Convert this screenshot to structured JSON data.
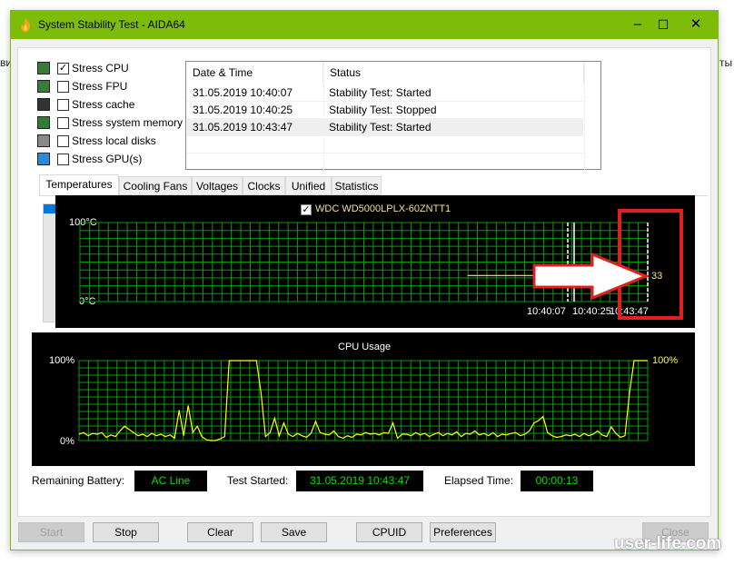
{
  "background_fragments": {
    "left": "ви",
    "right": "ты"
  },
  "window": {
    "title": "System Stability Test - AIDA64",
    "accent": "#7dbd0a",
    "controls": [
      "minimize",
      "maximize",
      "close"
    ]
  },
  "stress_options": [
    {
      "label": "Stress CPU",
      "checked": true,
      "icon": "cpu-icon"
    },
    {
      "label": "Stress FPU",
      "checked": false,
      "icon": "fpu-icon"
    },
    {
      "label": "Stress cache",
      "checked": false,
      "icon": "cache-chip-icon"
    },
    {
      "label": "Stress system memory",
      "checked": false,
      "icon": "memory-module-icon"
    },
    {
      "label": "Stress local disks",
      "checked": false,
      "icon": "disk-drive-icon"
    },
    {
      "label": "Stress GPU(s)",
      "checked": false,
      "icon": "gpu-monitor-icon"
    }
  ],
  "log": {
    "columns": [
      "Date & Time",
      "Status"
    ],
    "rows": [
      {
        "datetime": "31.05.2019 10:40:07",
        "status": "Stability Test: Started"
      },
      {
        "datetime": "31.05.2019 10:40:25",
        "status": "Stability Test: Stopped"
      },
      {
        "datetime": "31.05.2019 10:43:47",
        "status": "Stability Test: Started",
        "selected": true
      }
    ]
  },
  "tabs": [
    {
      "label": "Temperatures",
      "selected": true
    },
    {
      "label": "Cooling Fans"
    },
    {
      "label": "Voltages"
    },
    {
      "label": "Clocks"
    },
    {
      "label": "Unified"
    },
    {
      "label": "Statistics"
    }
  ],
  "chart_data": [
    {
      "type": "line",
      "title": "",
      "legend": {
        "label": "WDC WD5000LPLX-60ZNTT1",
        "checked": true,
        "color": "#f0e090"
      },
      "y_unit": "°C",
      "ylim": [
        0,
        100
      ],
      "ytick_labels": [
        "100°C",
        "0°C"
      ],
      "series": [
        {
          "name": "WDC WD5000LPLX-60ZNTT1",
          "color": "#ffe08a",
          "values": [
            null,
            null,
            null,
            null,
            null,
            null,
            null,
            null,
            null,
            null,
            null,
            null,
            null,
            null,
            null,
            null,
            null,
            null,
            null,
            null,
            null,
            null,
            null,
            null,
            null,
            null,
            null,
            null,
            null,
            null,
            null,
            null,
            null,
            null,
            null,
            null,
            null,
            null,
            null,
            null,
            null,
            null,
            null,
            33,
            33,
            33,
            33,
            33,
            33,
            33,
            33,
            33,
            33,
            33,
            33,
            33,
            33,
            33,
            33,
            33,
            33,
            33,
            33,
            33
          ]
        }
      ],
      "current_value_label": "33",
      "time_markers": [
        {
          "label": "10:40:07",
          "style": "dashed"
        },
        {
          "label": "10:40:25",
          "style": "solid"
        },
        {
          "label": "10:43:47",
          "style": "dashed"
        }
      ],
      "grid": true,
      "grid_color": "#00a000"
    },
    {
      "type": "line",
      "title": "CPU Usage",
      "ylim": [
        0,
        100
      ],
      "ytick_labels": [
        "100%",
        "0%"
      ],
      "current_value_label": "100%",
      "grid": true,
      "grid_color": "#00a000",
      "series": [
        {
          "color": "#ffff00",
          "values": [
            8,
            10,
            6,
            9,
            8,
            10,
            4,
            7,
            5,
            12,
            18,
            14,
            10,
            6,
            8,
            5,
            9,
            6,
            8,
            5,
            7,
            3,
            38,
            6,
            44,
            10,
            18,
            5,
            1,
            0,
            0,
            2,
            5,
            100,
            100,
            100,
            100,
            100,
            100,
            100,
            60,
            5,
            10,
            28,
            6,
            22,
            8,
            5,
            9,
            6,
            4,
            9,
            24,
            10,
            8,
            7,
            12,
            5,
            3,
            6,
            4,
            8,
            7,
            10,
            8,
            9,
            7,
            10,
            9,
            22,
            3,
            8,
            8,
            6,
            10,
            7,
            9,
            5,
            8,
            10,
            6,
            9,
            7,
            11,
            5,
            9,
            8,
            12,
            7,
            9,
            6,
            10,
            5,
            8,
            7,
            9,
            10,
            6,
            8,
            12,
            22,
            25,
            30,
            10,
            6,
            4,
            5,
            7,
            6,
            8,
            5,
            9,
            6,
            8,
            12,
            7,
            5,
            17,
            9,
            4,
            6,
            60,
            100,
            100,
            100,
            100
          ]
        }
      ]
    }
  ],
  "annotation": {
    "highlight_color": "#e02020",
    "arrow": "pointing to current temperature"
  },
  "status": {
    "battery_label": "Remaining Battery:",
    "battery_value": "AC Line",
    "started_label": "Test Started:",
    "started_value": "31.05.2019 10:43:47",
    "elapsed_label": "Elapsed Time:",
    "elapsed_value": "00:00:13",
    "value_color": "#00e000"
  },
  "buttons": [
    {
      "label": "Start",
      "enabled": false
    },
    {
      "label": "Stop",
      "enabled": true
    },
    {
      "label": "Clear",
      "enabled": true
    },
    {
      "label": "Save",
      "enabled": true
    },
    {
      "label": "CPUID",
      "enabled": true
    },
    {
      "label": "Preferences",
      "enabled": true
    },
    {
      "label": "Close",
      "enabled": false
    }
  ],
  "watermark": "user-life.com"
}
